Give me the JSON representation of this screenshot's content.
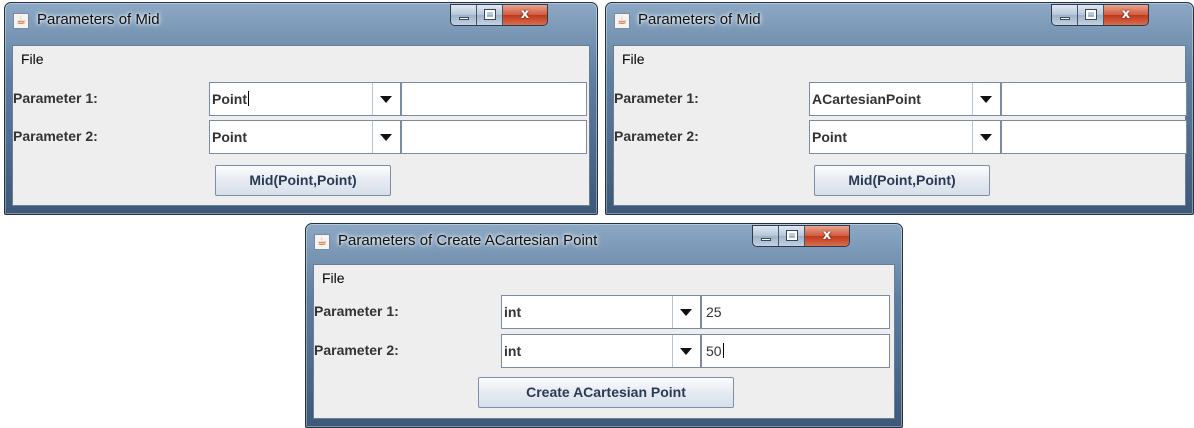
{
  "windows": [
    {
      "title": "Parameters of Mid",
      "menu": "File",
      "rows": [
        {
          "label": "Parameter 1:",
          "type": "Point",
          "value": ""
        },
        {
          "label": "Parameter 2:",
          "type": "Point",
          "value": ""
        }
      ],
      "button": "Mid(Point,Point)"
    },
    {
      "title": "Parameters of Mid",
      "menu": "File",
      "rows": [
        {
          "label": "Parameter 1:",
          "type": "ACartesianPoint",
          "value": ""
        },
        {
          "label": "Parameter 2:",
          "type": "Point",
          "value": ""
        }
      ],
      "button": "Mid(Point,Point)"
    },
    {
      "title": "Parameters of Create  ACartesian Point",
      "menu": "File",
      "rows": [
        {
          "label": "Parameter 1:",
          "type": "int",
          "value": "25"
        },
        {
          "label": "Parameter 2:",
          "type": "int",
          "value": "50"
        }
      ],
      "button": "Create  ACartesian Point"
    }
  ],
  "window_controls": {
    "close": "x"
  },
  "icons": {
    "app": "java-cup-icon"
  },
  "colors": {
    "client_bg": "#eeeeee",
    "label_text": "#333333",
    "button_text": "#2a3a55"
  }
}
